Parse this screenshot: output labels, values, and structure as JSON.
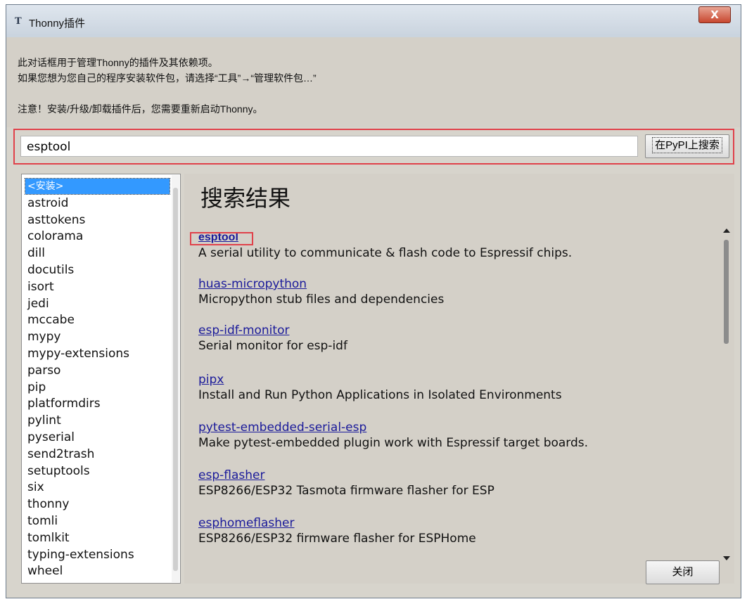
{
  "window": {
    "title": "Thonny插件",
    "close_symbol": "X"
  },
  "info": {
    "line1": "此对话框用于管理Thonny的插件及其依赖项。",
    "line2": "如果您想为您自己的程序安装软件包，请选择“工具”→“管理软件包…”",
    "line3": "注意！安装/升级/卸载插件后，您需要重新启动Thonny。"
  },
  "search": {
    "value": "esptool",
    "button_label": "在PyPI上搜索"
  },
  "packages": [
    "<安装>",
    "astroid",
    "asttokens",
    "colorama",
    "dill",
    "docutils",
    "isort",
    "jedi",
    "mccabe",
    "mypy",
    "mypy-extensions",
    "parso",
    "pip",
    "platformdirs",
    "pylint",
    "pyserial",
    "send2trash",
    "setuptools",
    "six",
    "thonny",
    "tomli",
    "tomlkit",
    "typing-extensions",
    "wheel"
  ],
  "results": {
    "heading": "搜索结果",
    "items": [
      {
        "name": "esptool",
        "desc": "A serial utility to communicate & flash code to Espressif chips."
      },
      {
        "name": "huas-micropython",
        "desc": "Micropython stub files and dependencies"
      },
      {
        "name": "esp-idf-monitor",
        "desc": "Serial monitor for esp-idf"
      },
      {
        "name": "pipx",
        "desc": "Install and Run Python Applications in Isolated Environments"
      },
      {
        "name": "pytest-embedded-serial-esp",
        "desc": "Make pytest-embedded plugin work with Espressif target boards."
      },
      {
        "name": "esp-flasher",
        "desc": "ESP8266/ESP32 Tasmota firmware flasher for ESP"
      },
      {
        "name": "esphomeflasher",
        "desc": "ESP8266/ESP32 firmware flasher for ESPHome"
      }
    ]
  },
  "footer": {
    "close_label": "关闭"
  }
}
